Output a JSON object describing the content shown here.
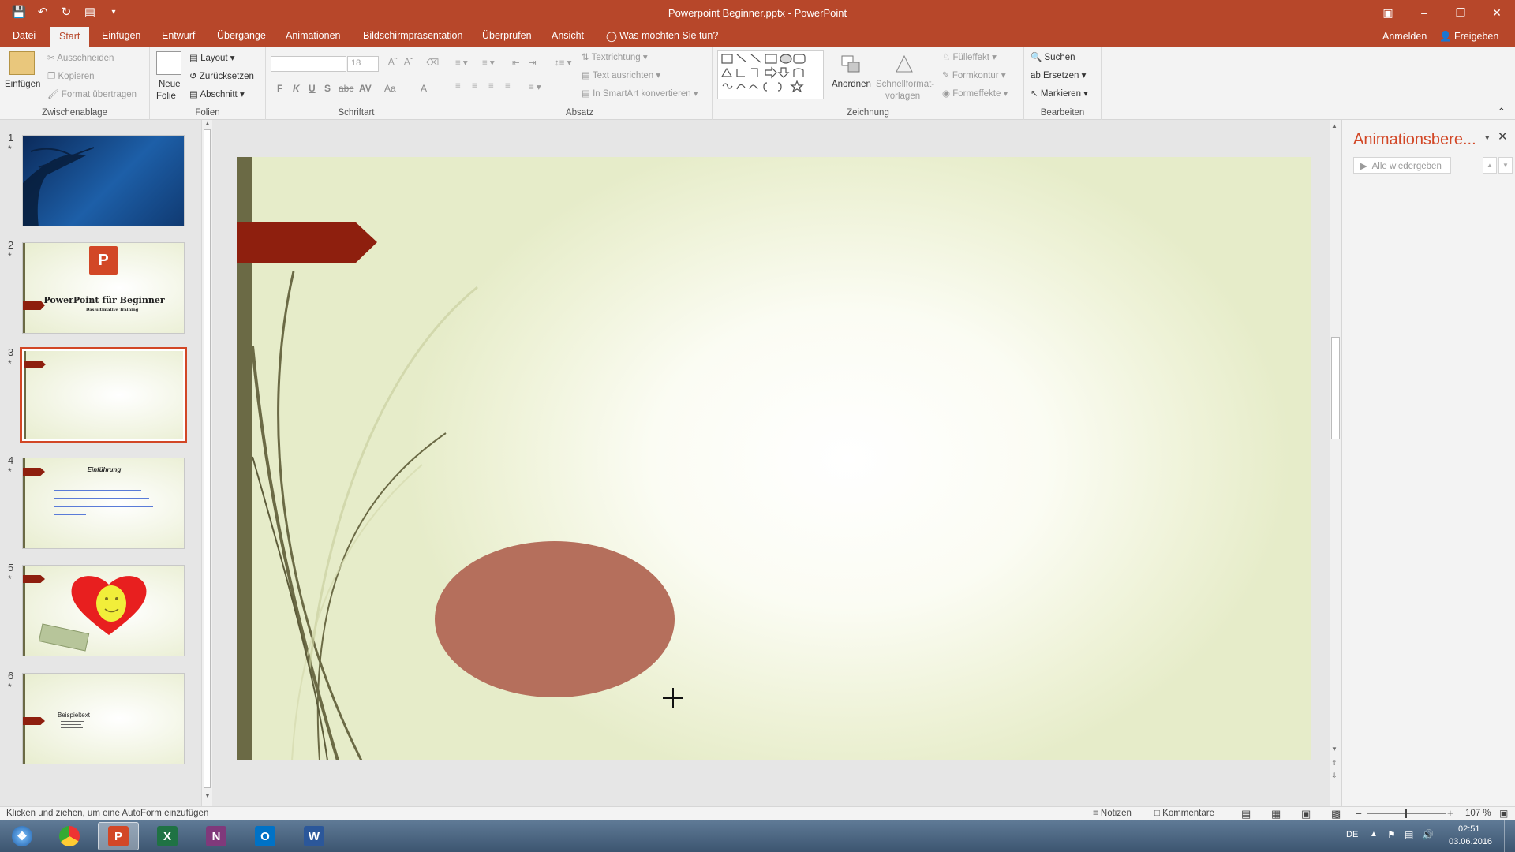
{
  "window": {
    "title": "Powerpoint Beginner.pptx - PowerPoint"
  },
  "tabs": [
    "Datei",
    "Start",
    "Einfügen",
    "Entwurf",
    "Übergänge",
    "Animationen",
    "Bildschirmpräsentation",
    "Überprüfen",
    "Ansicht"
  ],
  "tell_me": "Was möchten Sie tun?",
  "signin": "Anmelden",
  "share": "Freigeben",
  "ribbon": {
    "clipboard": {
      "paste": "Einfügen",
      "cut": "Ausschneiden",
      "copy": "Kopieren",
      "format_painter": "Format übertragen",
      "label": "Zwischenablage"
    },
    "slides": {
      "new_slide_1": "Neue",
      "new_slide_2": "Folie",
      "layout": "Layout",
      "reset": "Zurücksetzen",
      "section": "Abschnitt",
      "label": "Folien"
    },
    "font": {
      "size": "18",
      "bold": "F",
      "italic": "K",
      "underline": "U",
      "shadow": "S",
      "strike": "abc",
      "spacing": "AV",
      "case": "Aa",
      "color": "A",
      "label": "Schriftart"
    },
    "paragraph": {
      "text_direction": "Textrichtung",
      "align_text": "Text ausrichten",
      "smartart": "In SmartArt konvertieren",
      "label": "Absatz"
    },
    "drawing": {
      "arrange": "Anordnen",
      "quick_styles_1": "Schnellformat-",
      "quick_styles_2": "vorlagen",
      "fill": "Fülleffekt",
      "outline": "Formkontur",
      "effects": "Formeffekte",
      "label": "Zeichnung"
    },
    "editing": {
      "find": "Suchen",
      "replace": "Ersetzen",
      "select": "Markieren",
      "label": "Bearbeiten"
    }
  },
  "thumbnails": [
    {
      "num": "1",
      "star": "*"
    },
    {
      "num": "2",
      "star": "*",
      "title": "PowerPoint für Beginner",
      "subtitle": "Das ultimative Training"
    },
    {
      "num": "3",
      "star": "*"
    },
    {
      "num": "4",
      "star": "*",
      "title": "Einführung"
    },
    {
      "num": "5",
      "star": "*"
    },
    {
      "num": "6",
      "star": "*",
      "title": "Beispieltext"
    }
  ],
  "animation_pane": {
    "title": "Animationsbere...",
    "play_all": "Alle wiedergeben"
  },
  "status": {
    "hint": "Klicken und ziehen, um eine AutoForm einzufügen",
    "notes": "Notizen",
    "comments": "Kommentare",
    "zoom": "107 %"
  },
  "taskbar": {
    "lang": "DE",
    "time": "02:51",
    "date": "03.06.2016"
  },
  "colors": {
    "accent": "#b7472a",
    "shape_fill": "#b56f5c",
    "banner": "#8e1f0e",
    "selected_thumb": "#d24726"
  }
}
